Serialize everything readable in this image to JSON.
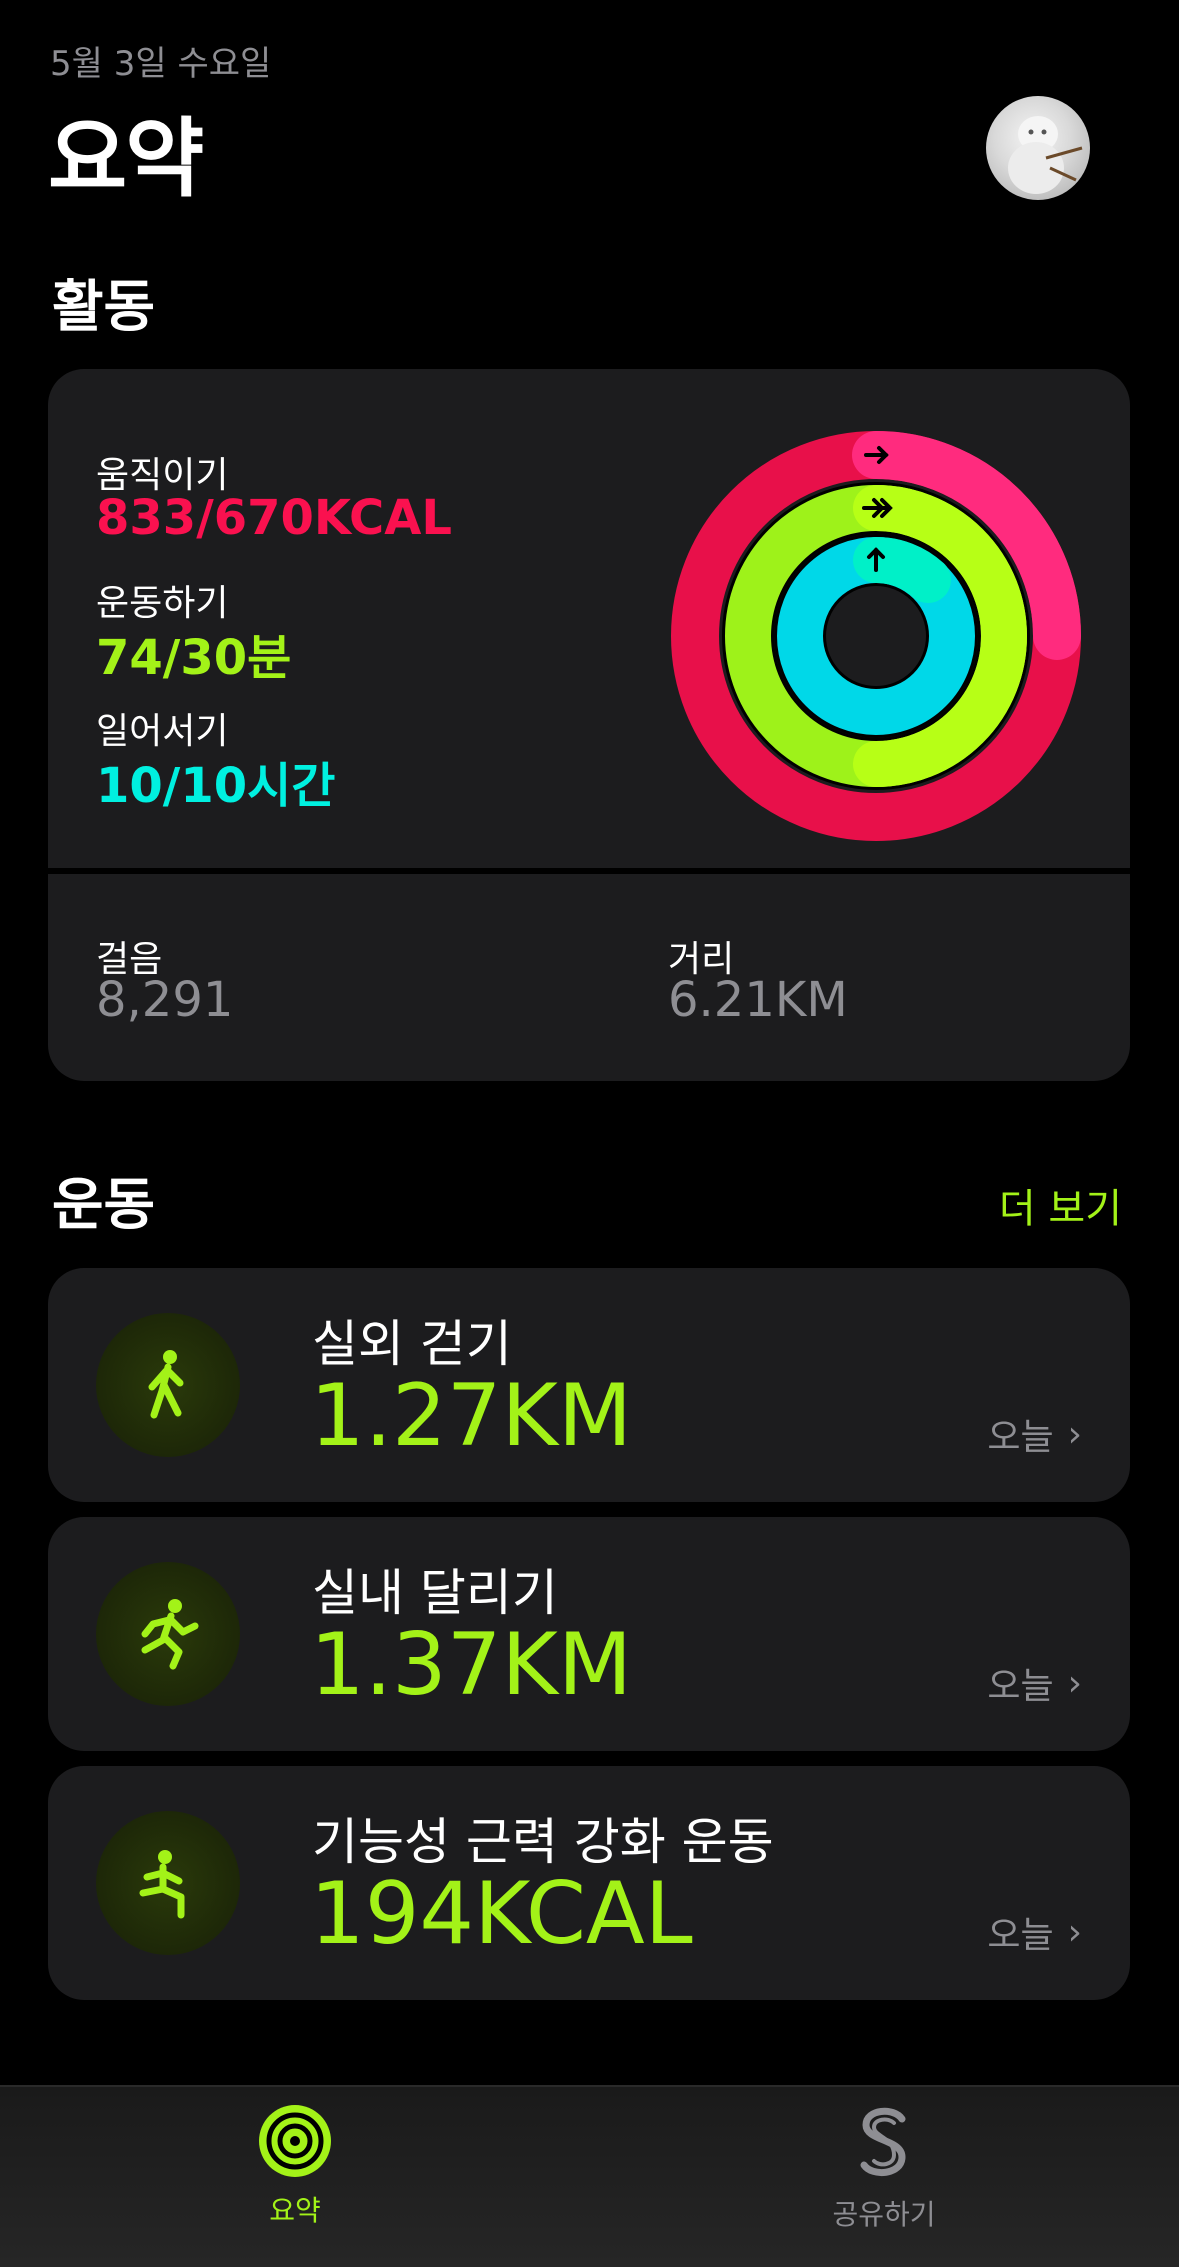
{
  "header": {
    "date": "5월 3일 수요일",
    "title": "요약"
  },
  "activity": {
    "heading": "활동",
    "move": {
      "label": "움직이기",
      "value": "833/670KCAL",
      "color": "#fa114f"
    },
    "exercise": {
      "label": "운동하기",
      "value": "74/30분",
      "color": "#a3f218"
    },
    "stand": {
      "label": "일어서기",
      "value": "10/10시간",
      "color": "#00f0e0"
    },
    "steps": {
      "label": "걸음",
      "value": "8,291"
    },
    "distance": {
      "label": "거리",
      "value": "6.21KM"
    }
  },
  "workouts": {
    "heading": "운동",
    "more_label": "더 보기",
    "items": [
      {
        "name": "실외 걷기",
        "value": "1.27KM",
        "day": "오늘",
        "icon": "walking-figure-icon"
      },
      {
        "name": "실내 달리기",
        "value": "1.37KM",
        "day": "오늘",
        "icon": "running-figure-icon"
      },
      {
        "name": "기능성 근력 강화 운동",
        "value": "194KCAL",
        "day": "오늘",
        "icon": "strength-figure-icon"
      }
    ]
  },
  "tabbar": {
    "tabs": [
      {
        "label": "요약",
        "active": true
      },
      {
        "label": "공유하기",
        "active": false
      }
    ]
  },
  "colors": {
    "accent": "#a3f218",
    "card": "#1c1c1e",
    "secondary_text": "#8e8e93"
  }
}
